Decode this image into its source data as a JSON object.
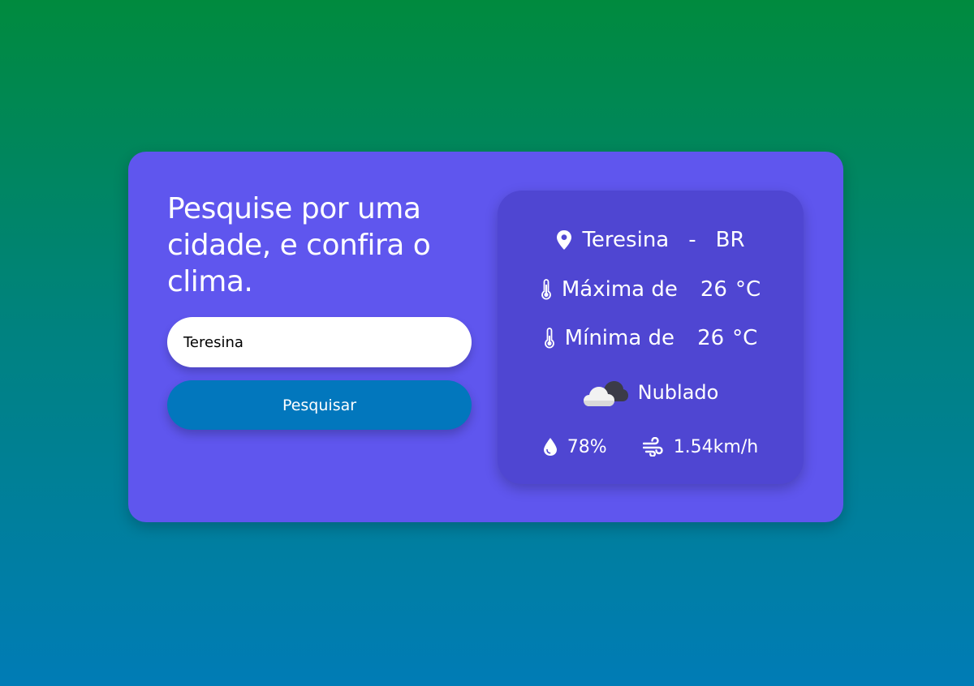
{
  "search": {
    "title": "Pesquise por uma cidade, e confira o clima.",
    "input_value": "Teresina",
    "button_label": "Pesquisar"
  },
  "weather": {
    "city": "Teresina",
    "separator": "-",
    "country": "BR",
    "max_label": "Máxima de",
    "max_value": "26",
    "min_label": "Mínima de",
    "min_value": "26",
    "temp_unit": "°C",
    "description": "Nublado",
    "humidity": "78%",
    "wind": "1.54km/h"
  },
  "icons": {
    "location": "map-pin-icon",
    "max_temp": "thermometer-icon",
    "min_temp": "thermometer-icon",
    "condition": "cloud-icon",
    "humidity": "water-drop-icon",
    "wind": "wind-icon"
  },
  "colors": {
    "card": "#5f56ee",
    "panel": "#4f46d2",
    "button": "#0277bd",
    "gradient_top": "#008a3e",
    "gradient_bottom": "#007cb6"
  }
}
